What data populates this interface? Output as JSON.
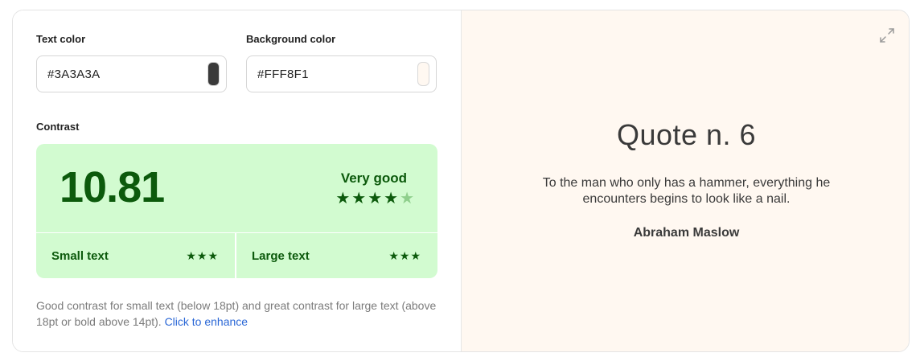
{
  "text_color": {
    "label": "Text color",
    "value": "#3A3A3A",
    "swatch": "#3A3A3A"
  },
  "background_color": {
    "label": "Background color",
    "value": "#FFF8F1",
    "swatch": "#FFF8F1"
  },
  "contrast": {
    "label": "Contrast",
    "ratio": "10.81",
    "rating": "Very good",
    "stars_filled": 4,
    "stars_total": 5,
    "small_text": {
      "label": "Small text",
      "stars": "★★★"
    },
    "large_text": {
      "label": "Large text",
      "stars": "★★★"
    },
    "description": "Good contrast for small text (below 18pt) and great contrast for large text (above 18pt or bold above 14pt).",
    "enhance_link": "Click to enhance",
    "colors": {
      "good_bg": "#D2FBD0",
      "good_fg": "#0C5A0C",
      "dim_star": "#8FCF8C"
    }
  },
  "preview": {
    "title": "Quote n. 6",
    "quote": "To the man who only has a hammer, everything he encounters begins to look like a nail.",
    "author": "Abraham Maslow",
    "expand_icon": "expand-icon"
  }
}
